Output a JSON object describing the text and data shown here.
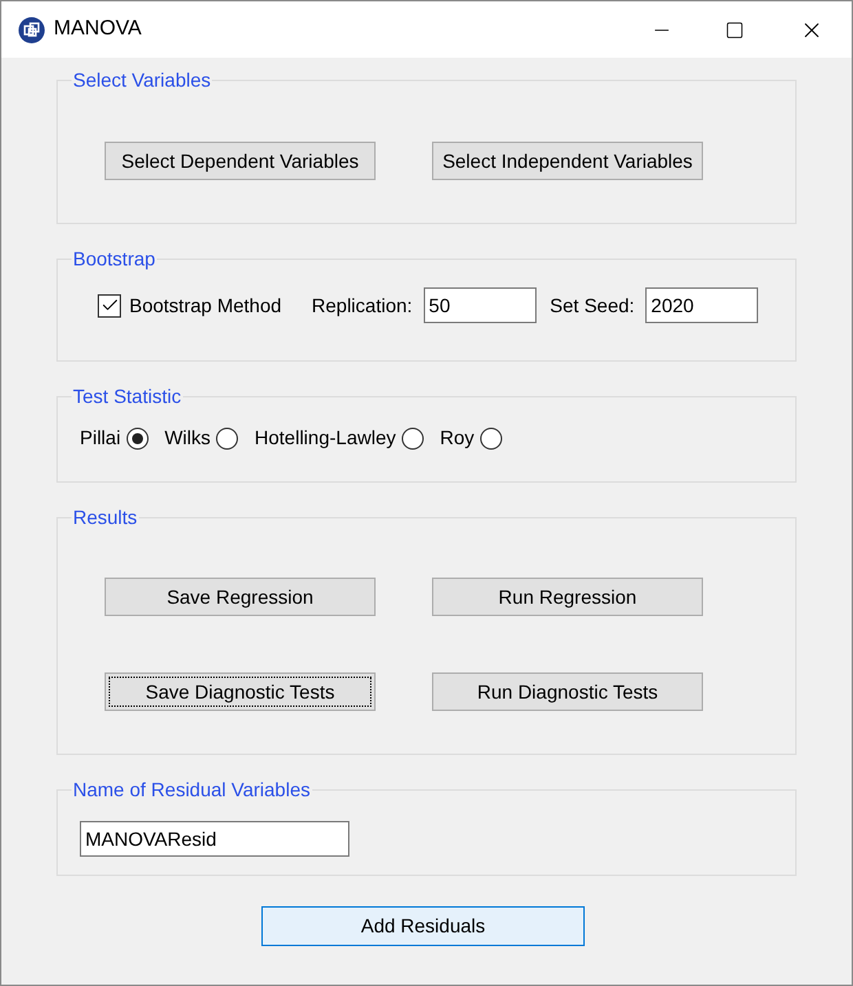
{
  "window": {
    "title": "MANOVA"
  },
  "select_variables": {
    "title": "Select Variables",
    "buttons": [
      {
        "label": "Select Dependent Variables",
        "focused": false
      },
      {
        "label": "Select Independent Variables",
        "focused": false
      }
    ]
  },
  "bootstrap": {
    "title": "Bootstrap",
    "method": {
      "label": "Bootstrap Method",
      "checked": true
    },
    "replication": {
      "label": "Replication:",
      "value": "50"
    },
    "seed": {
      "label": "Set Seed:",
      "value": "2020"
    }
  },
  "test_statistic": {
    "title": "Test Statistic",
    "options": [
      {
        "label": "Pillai",
        "selected": true
      },
      {
        "label": "Wilks",
        "selected": false
      },
      {
        "label": "Hotelling-Lawley",
        "selected": false
      },
      {
        "label": "Roy",
        "selected": false
      }
    ]
  },
  "results": {
    "title": "Results",
    "buttons": [
      {
        "label": "Save Regression",
        "focused": false
      },
      {
        "label": "Run Regression",
        "focused": false
      },
      {
        "label": "Save Diagnostic Tests",
        "focused": true
      },
      {
        "label": "Run Diagnostic Tests",
        "focused": false
      }
    ]
  },
  "residuals": {
    "title": "Name of Residual Variables",
    "value": "MANOVAResid"
  },
  "add_button": {
    "label": "Add Residuals",
    "default": true
  }
}
